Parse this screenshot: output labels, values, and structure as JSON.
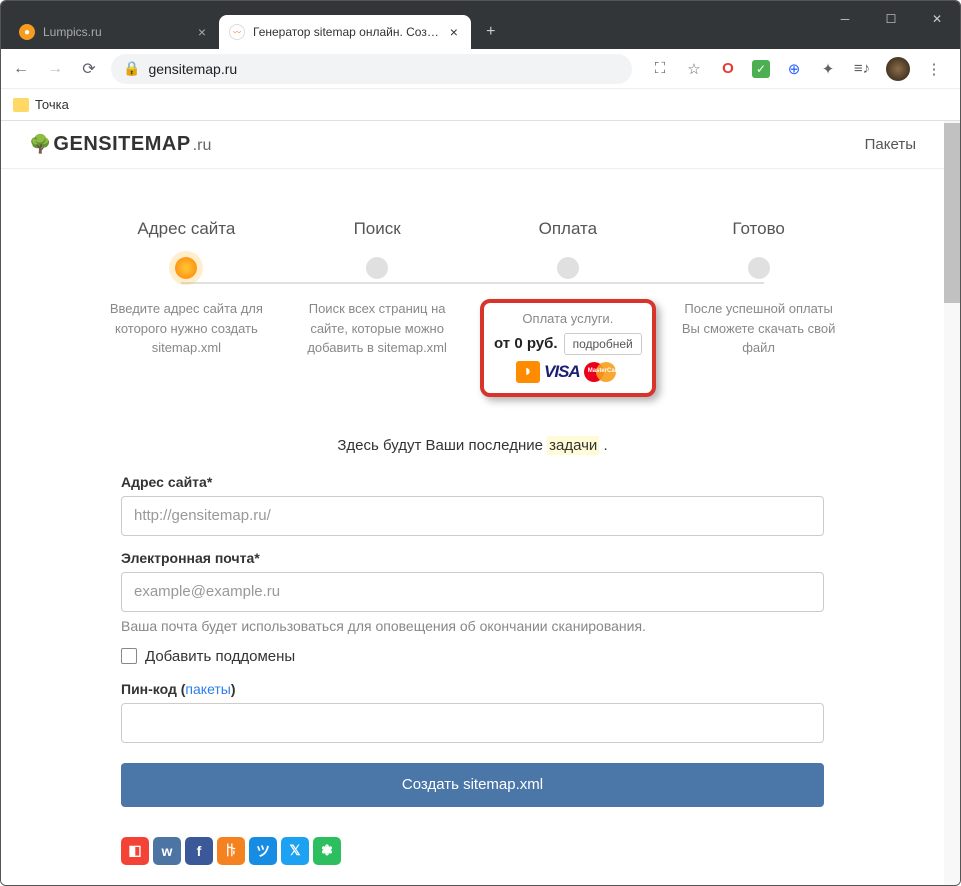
{
  "browser": {
    "tabs": [
      {
        "title": "Lumpics.ru",
        "active": false
      },
      {
        "title": "Генератор sitemap онлайн. Соз…",
        "active": true
      }
    ],
    "url": "gensitemap.ru",
    "bookmark": "Точка"
  },
  "nav_link": "Пакеты",
  "logo": {
    "main": "GENSITEMAP",
    "suffix": ".ru"
  },
  "steps": [
    {
      "title": "Адрес сайта",
      "desc": "Введите адрес сайта для которого нужно создать sitemap.xml",
      "active": true
    },
    {
      "title": "Поиск",
      "desc": "Поиск всех страниц на сайте, которые можно добавить в sitemap.xml",
      "active": false
    },
    {
      "title": "Оплата",
      "desc": "Оплата услуги.",
      "active": false,
      "highlighted": true,
      "price": "от 0 руб.",
      "details": "подробней"
    },
    {
      "title": "Готово",
      "desc": "После успешной оплаты Вы сможете скачать свой файл",
      "active": false
    }
  ],
  "recent": {
    "prefix": "Здесь будут Ваши последние ",
    "hl": "задачи",
    "suffix": " ."
  },
  "form": {
    "address_label": "Адрес сайта*",
    "address_placeholder": "http://gensitemap.ru/",
    "email_label": "Электронная почта*",
    "email_placeholder": "example@example.ru",
    "email_hint": "Ваша почта будет использоваться для оповещения об окончании сканирования.",
    "checkbox_label": "Добавить поддомены",
    "pin_label": "Пин-код (",
    "pin_link": "пакеты",
    "pin_close": ")",
    "submit": "Создать sitemap.xml"
  },
  "social_colors": [
    "#f44336",
    "#4c75a3",
    "#3b5998",
    "#f58220",
    "#168de2",
    "#1da1f2",
    "#2dbe60"
  ]
}
